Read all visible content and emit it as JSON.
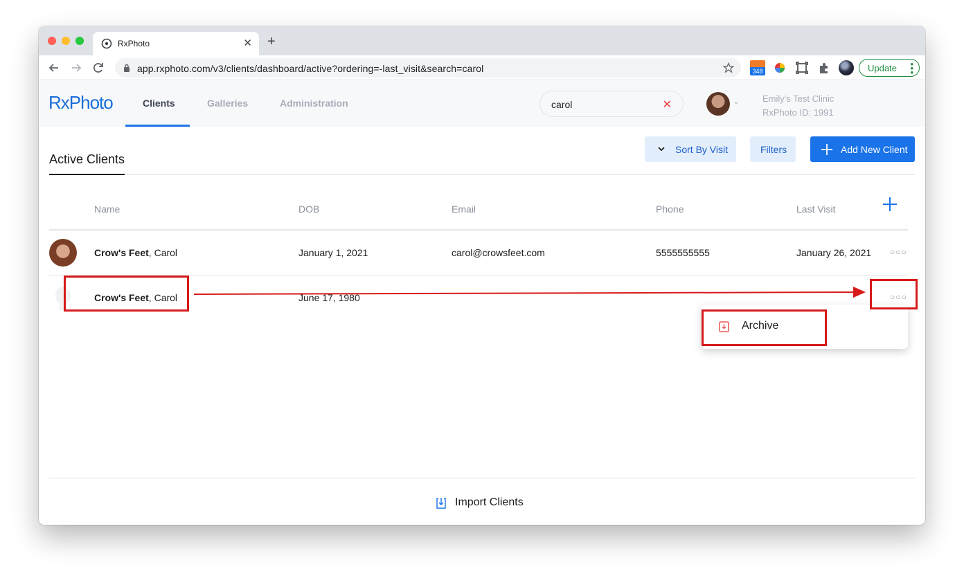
{
  "browser": {
    "tab_title": "RxPhoto",
    "url": "app.rxphoto.com/v3/clients/dashboard/active?ordering=-last_visit&search=carol",
    "extension_badge": "348",
    "update_label": "Update"
  },
  "app": {
    "logo_text": "RxPhoto",
    "nav": [
      "Clients",
      "Galleries",
      "Administration"
    ],
    "active_nav": "Clients",
    "search_value": "carol",
    "clinic_name": "Emily's Test Clinic",
    "clinic_id": "RxPhoto ID: 1991"
  },
  "toolbar": {
    "sort_label": "Sort By Visit",
    "filters_label": "Filters",
    "add_label": "Add New Client"
  },
  "page_title": "Active Clients",
  "table": {
    "columns": [
      "Name",
      "DOB",
      "Email",
      "Phone",
      "Last Visit"
    ],
    "rows": [
      {
        "last": "Crow's Feet",
        "first": "Carol",
        "dob": "January 1, 2021",
        "email": "carol@crowsfeet.com",
        "phone": "5555555555",
        "last_visit": "January 26, 2021"
      },
      {
        "last": "Crow's Feet",
        "first": "Carol",
        "dob": "June 17, 1980",
        "email": "",
        "phone": "",
        "last_visit": ""
      }
    ]
  },
  "row_menu": {
    "items": [
      "Archive"
    ]
  },
  "footer": {
    "import_label": "Import Clients"
  },
  "colors": {
    "accent": "#1a73e8",
    "annotation": "#d71a1a",
    "archive_icon": "#e53935"
  }
}
